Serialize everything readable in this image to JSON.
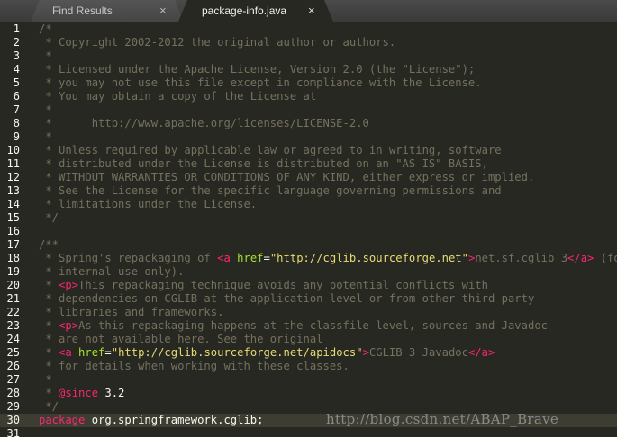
{
  "tabs": [
    {
      "label": "Find Results",
      "close": "×"
    },
    {
      "label": "package-info.java",
      "close": "×"
    }
  ],
  "line_numbers": [
    "1",
    "2",
    "3",
    "4",
    "5",
    "6",
    "7",
    "8",
    "9",
    "10",
    "11",
    "12",
    "13",
    "14",
    "15",
    "16",
    "17",
    "18",
    "19",
    "20",
    "21",
    "22",
    "23",
    "24",
    "25",
    "26",
    "27",
    "28",
    "29",
    "30",
    "31"
  ],
  "code": {
    "l1": "/*",
    "l2": " * Copyright 2002-2012 the original author or authors.",
    "l3": " *",
    "l4": " * Licensed under the Apache License, Version 2.0 (the \"License\");",
    "l5": " * you may not use this file except in compliance with the License.",
    "l6": " * You may obtain a copy of the License at",
    "l7": " *",
    "l8": " *      http://www.apache.org/licenses/LICENSE-2.0",
    "l9": " *",
    "l10": " * Unless required by applicable law or agreed to in writing, software",
    "l11": " * distributed under the License is distributed on an \"AS IS\" BASIS,",
    "l12": " * WITHOUT WARRANTIES OR CONDITIONS OF ANY KIND, either express or implied.",
    "l13": " * See the License for the specific language governing permissions and",
    "l14": " * limitations under the License.",
    "l15": " */",
    "l16": "",
    "l17": "/**",
    "l18_pre": " * Spring's repackaging of ",
    "l18_tag_open": "<a",
    "l18_attr": " href",
    "l18_eq": "=",
    "l18_str": "\"http://cglib.sourceforge.net\"",
    "l18_gt": ">",
    "l18_text": "net.sf.cglib 3",
    "l18_tag_close": "</a>",
    "l18_post": " (for",
    "l19": " * internal use only).",
    "l20_pre": " * ",
    "l20_tag": "<p>",
    "l20_text": "This repackaging technique avoids any potential conflicts with",
    "l21": " * dependencies on CGLIB at the application level or from other third-party",
    "l22": " * libraries and frameworks.",
    "l23_pre": " * ",
    "l23_tag": "<p>",
    "l23_text": "As this repackaging happens at the classfile level, sources and Javadoc",
    "l24": " * are not available here. See the original",
    "l25_pre": " * ",
    "l25_tag_open": "<a",
    "l25_attr": " href",
    "l25_eq": "=",
    "l25_str": "\"http://cglib.sourceforge.net/apidocs\"",
    "l25_gt": ">",
    "l25_text": "CGLIB 3 Javadoc",
    "l25_tag_close": "</a>",
    "l26": " * for details when working with these classes.",
    "l27": " *",
    "l28_pre": " * ",
    "l28_tag": "@since",
    "l28_text": " 3.2",
    "l29": " */",
    "l30_kw": "package",
    "l30_text": " org.springframework.cglib;",
    "l31": ""
  },
  "watermark": "http://blog.csdn.net/ABAP_Brave"
}
